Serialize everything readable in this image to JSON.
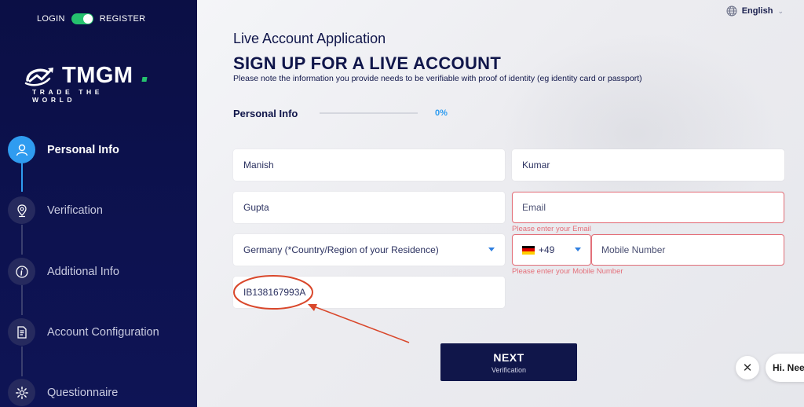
{
  "auth": {
    "login": "LOGIN",
    "register": "REGISTER"
  },
  "logo": {
    "text": "TMGM",
    "tagline": "TRADE THE WORLD"
  },
  "steps": [
    {
      "label": "Personal Info",
      "icon": "user-icon",
      "active": true
    },
    {
      "label": "Verification",
      "icon": "location-pin-icon",
      "active": false
    },
    {
      "label": "Additional Info",
      "icon": "info-icon",
      "active": false
    },
    {
      "label": "Account Configuration",
      "icon": "document-icon",
      "active": false
    },
    {
      "label": "Questionnaire",
      "icon": "gear-icon",
      "active": false
    }
  ],
  "language": {
    "label": "English"
  },
  "header": {
    "app_title": "Live Account Application",
    "signup_title": "SIGN UP FOR A LIVE ACCOUNT",
    "notice": "Please note the information you provide needs to be verifiable with proof of identity (eg identity card or passport)"
  },
  "progress": {
    "label": "Personal Info",
    "percent_text": "0%",
    "value": 0
  },
  "form": {
    "first_name": "Manish",
    "last_name": "Kumar",
    "middle_name": "Gupta",
    "email_placeholder": "Email",
    "email_error": "Please enter your Email",
    "country": "Germany (*Country/Region of your Residence)",
    "phone_code": "+49",
    "mobile_placeholder": "Mobile Number",
    "mobile_error": "Please enter your Mobile Number",
    "referral_code": "IB138167993A"
  },
  "next_button": {
    "label": "NEXT",
    "sublabel": "Verification"
  },
  "chat": {
    "greeting": "Hi. Need"
  },
  "colors": {
    "sidebar_bg": "#0b0f45",
    "accent_blue": "#2f9cf0",
    "brand_green": "#25c26e",
    "error_red": "#e4707a",
    "annotation_red": "#d9472b",
    "button_navy": "#10164a"
  }
}
